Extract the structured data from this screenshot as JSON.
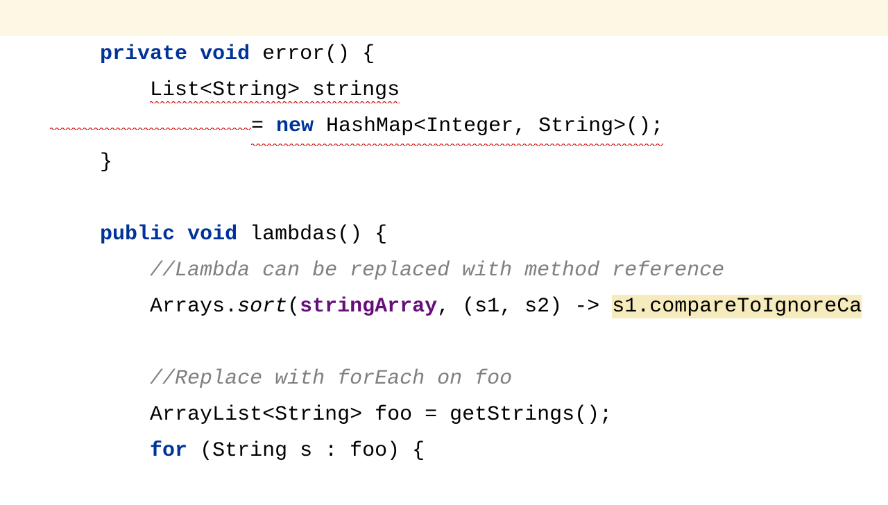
{
  "line1": {
    "indent": "    ",
    "kw_private": "private",
    "space1": " ",
    "kw_void": "void",
    "space2": " ",
    "method": "error",
    "rest": "() {"
  },
  "line2": {
    "indent": "        ",
    "err_text": "List<String> strings"
  },
  "line3": {
    "indent": "                ",
    "eq": "= ",
    "kw_new": "new",
    "err_text": " HashMap<Integer, String>();"
  },
  "line4": {
    "indent": "    ",
    "brace": "}"
  },
  "line5": {
    "text": ""
  },
  "line6": {
    "indent": "    ",
    "kw_public": "public",
    "space1": " ",
    "kw_void": "void",
    "space2": " ",
    "method": "lambdas",
    "rest": "() {"
  },
  "line7": {
    "indent": "        ",
    "comment": "//Lambda can be replaced with method reference"
  },
  "line8": {
    "indent": "        ",
    "arrays": "Arrays.",
    "sort": "sort",
    "paren": "(",
    "field": "stringArray",
    "mid": ", (s1, s2) -> ",
    "warn": "s1.compareToIgnoreCa"
  },
  "line9": {
    "text": ""
  },
  "line10": {
    "indent": "        ",
    "comment": "//Replace with forEach on foo"
  },
  "line11": {
    "indent": "        ",
    "text1": "ArrayList<String> foo = getStrings();"
  },
  "line12": {
    "indent": "        ",
    "kw_for": "for",
    "text1": " (String s : foo) {"
  }
}
